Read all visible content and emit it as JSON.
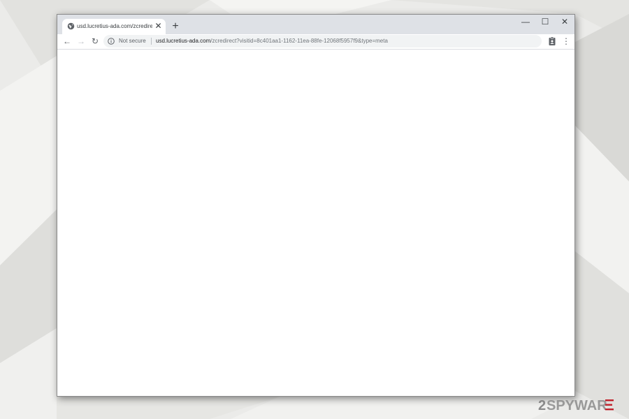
{
  "browser": {
    "tab": {
      "title": "usd.lucretius-ada.com/zcredirect",
      "close_glyph": "✕",
      "favicon": "globe-icon"
    },
    "new_tab_glyph": "+",
    "window_controls": {
      "minimize": "—",
      "maximize": "☐",
      "close": "✕"
    },
    "toolbar": {
      "back": "←",
      "forward": "→",
      "reload": "↻",
      "security_label": "Not secure",
      "url_host": "usd.lucretius-ada.com",
      "url_path": "/zcredirect?visitid=8c401aa1-1162-11ea-88fe-12068f5957f9&type=meta",
      "menu": "⋮"
    }
  },
  "watermark": {
    "text": "2SPYWARE",
    "accent": "#c0202a"
  },
  "colors": {
    "tabstrip": "#dee1e6",
    "omnibox": "#f1f3f4",
    "page_background": "#ffffff"
  }
}
